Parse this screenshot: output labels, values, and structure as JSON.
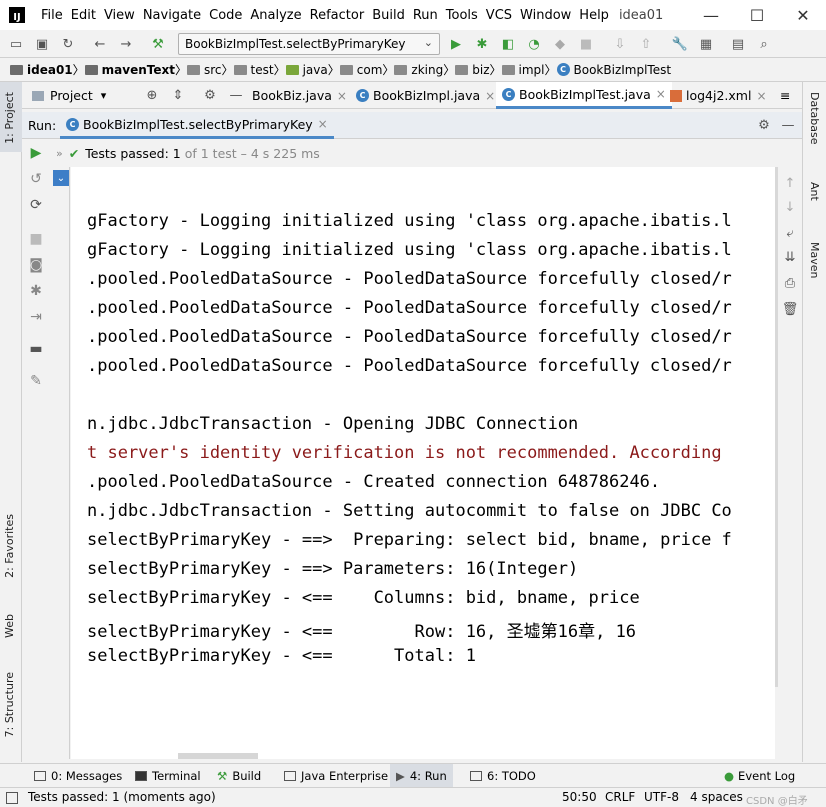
{
  "app": {
    "logo": "IJ",
    "menu": [
      "File",
      "Edit",
      "View",
      "Navigate",
      "Code",
      "Analyze",
      "Refactor",
      "Build",
      "Run",
      "Tools",
      "VCS",
      "Window",
      "Help"
    ],
    "project_name": "idea01",
    "window_controls": {
      "minimize": "—",
      "maximize": "☐",
      "close": "✕"
    }
  },
  "toolbar": {
    "run_config": "BookBizImplTest.selectByPrimaryKey",
    "icons": [
      "folder-open-icon",
      "save-icon",
      "sync-icon",
      "back-icon",
      "forward-icon",
      "build-icon",
      "run-icon",
      "debug-icon",
      "coverage-icon",
      "profile-icon",
      "run-ant-icon",
      "stop-icon",
      "vcs-update-icon",
      "vcs-commit-icon",
      "settings-icon",
      "project-structure-icon",
      "terminal-icon",
      "search-icon"
    ]
  },
  "breadcrumb": [
    {
      "label": "idea01",
      "bold": true,
      "color": "#6b6b6b"
    },
    {
      "label": "mavenText",
      "bold": true,
      "color": "#6b6b6b"
    },
    {
      "label": "src",
      "bold": false,
      "color": "#8a8a8a"
    },
    {
      "label": "test",
      "bold": false,
      "color": "#8a8a8a"
    },
    {
      "label": "java",
      "bold": false,
      "color": "#7aa63a"
    },
    {
      "label": "com",
      "bold": false,
      "color": "#8a8a8a"
    },
    {
      "label": "zking",
      "bold": false,
      "color": "#8a8a8a"
    },
    {
      "label": "biz",
      "bold": false,
      "color": "#8a8a8a"
    },
    {
      "label": "impl",
      "bold": false,
      "color": "#8a8a8a"
    },
    {
      "label": "BookBizImplTest",
      "bold": false,
      "color": "#3a7fc1",
      "class_icon": true
    }
  ],
  "project_panel": {
    "label": "Project",
    "chevron": "▾"
  },
  "editor_tabs": [
    {
      "label": "BookBiz.java",
      "active": false
    },
    {
      "label": "BookBizImpl.java",
      "active": false
    },
    {
      "label": "BookBizImplTest.java",
      "active": true
    },
    {
      "label": "log4j2.xml",
      "active": false
    }
  ],
  "editor_tab_overflow": "≡",
  "left_strip": {
    "project": "1: Project",
    "favorites": "2: Favorites",
    "web": "Web",
    "structure": "7: Structure"
  },
  "right_strip": {
    "database": "Database",
    "ant": "Ant",
    "maven": "Maven"
  },
  "run_panel": {
    "label": "Run:",
    "tab": "BookBizImplTest.selectByPrimaryKey",
    "status_prefix": "Tests passed:",
    "status_count": "1",
    "status_rest": "of 1 test – 4 s 225 ms"
  },
  "console_lines": [
    {
      "text": "",
      "warn": false
    },
    {
      "text": "gFactory - Logging initialized using 'class org.apache.ibatis.l",
      "warn": false
    },
    {
      "text": "gFactory - Logging initialized using 'class org.apache.ibatis.l",
      "warn": false
    },
    {
      "text": ".pooled.PooledDataSource - PooledDataSource forcefully closed/r",
      "warn": false
    },
    {
      "text": ".pooled.PooledDataSource - PooledDataSource forcefully closed/r",
      "warn": false
    },
    {
      "text": ".pooled.PooledDataSource - PooledDataSource forcefully closed/r",
      "warn": false
    },
    {
      "text": ".pooled.PooledDataSource - PooledDataSource forcefully closed/r",
      "warn": false
    },
    {
      "text": "",
      "warn": false
    },
    {
      "text": "n.jdbc.JdbcTransaction - Opening JDBC Connection",
      "warn": false
    },
    {
      "text": "t server's identity verification is not recommended. According",
      "warn": true
    },
    {
      "text": ".pooled.PooledDataSource - Created connection 648786246.",
      "warn": false
    },
    {
      "text": "n.jdbc.JdbcTransaction - Setting autocommit to false on JDBC Co",
      "warn": false
    },
    {
      "text": "selectByPrimaryKey - ==>  Preparing: select bid, bname, price f",
      "warn": false
    },
    {
      "text": "selectByPrimaryKey - ==> Parameters: 16(Integer)",
      "warn": false
    },
    {
      "text": "selectByPrimaryKey - <==    Columns: bid, bname, price",
      "warn": false
    },
    {
      "text": "selectByPrimaryKey - <==        Row: 16, 圣墟第16章, 16",
      "warn": false
    },
    {
      "text": "selectByPrimaryKey - <==      Total: 1",
      "warn": false
    }
  ],
  "bottom_tabs": [
    {
      "label": "0: Messages",
      "active": false
    },
    {
      "label": "Terminal",
      "active": false
    },
    {
      "label": "Build",
      "active": false
    },
    {
      "label": "Java Enterprise",
      "active": false
    },
    {
      "label": "4: Run",
      "active": true
    },
    {
      "label": "6: TODO",
      "active": false
    }
  ],
  "event_log": "Event Log",
  "statusbar": {
    "message": "Tests passed: 1 (moments ago)",
    "position": "50:50",
    "line_sep": "CRLF",
    "encoding": "UTF-8",
    "indent": "4 spaces",
    "watermark": "CSDN @白矛"
  },
  "colors": {
    "accent": "#4a88c7",
    "run_green": "#3a9b3a",
    "warn_red": "#8b1a1a"
  }
}
